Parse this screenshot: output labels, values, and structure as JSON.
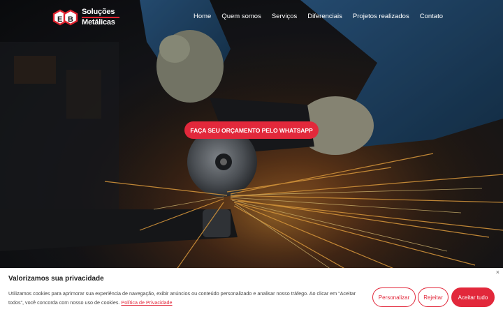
{
  "header": {
    "logo_line1": "Soluções",
    "logo_line2": "Metálicas",
    "logo_letters": "E B"
  },
  "nav": {
    "items": [
      "Home",
      "Quem somos",
      "Serviços",
      "Diferenciais",
      "Projetos realizados",
      "Contato"
    ]
  },
  "hero": {
    "cta_label": "FAÇA SEU ORÇAMENTO PELO WHATSAPP"
  },
  "cookie_banner": {
    "close": "×",
    "title": "Valorizamos sua privacidade",
    "text": "Utilizamos cookies para aprimorar sua experiência de navegação, exibir anúncios ou conteúdo personalizado e analisar nosso tráfego. Ao clicar em “Aceitar todos”, você concorda com nosso uso de cookies.",
    "policy_link": "Política de Privacidade",
    "customize_label": "Personalizar",
    "reject_label": "Rejeitar",
    "accept_label": "Aceitar tudo"
  },
  "colors": {
    "accent": "#e2283b",
    "nav_text": "#ffffff",
    "banner_bg": "#ffffff"
  }
}
